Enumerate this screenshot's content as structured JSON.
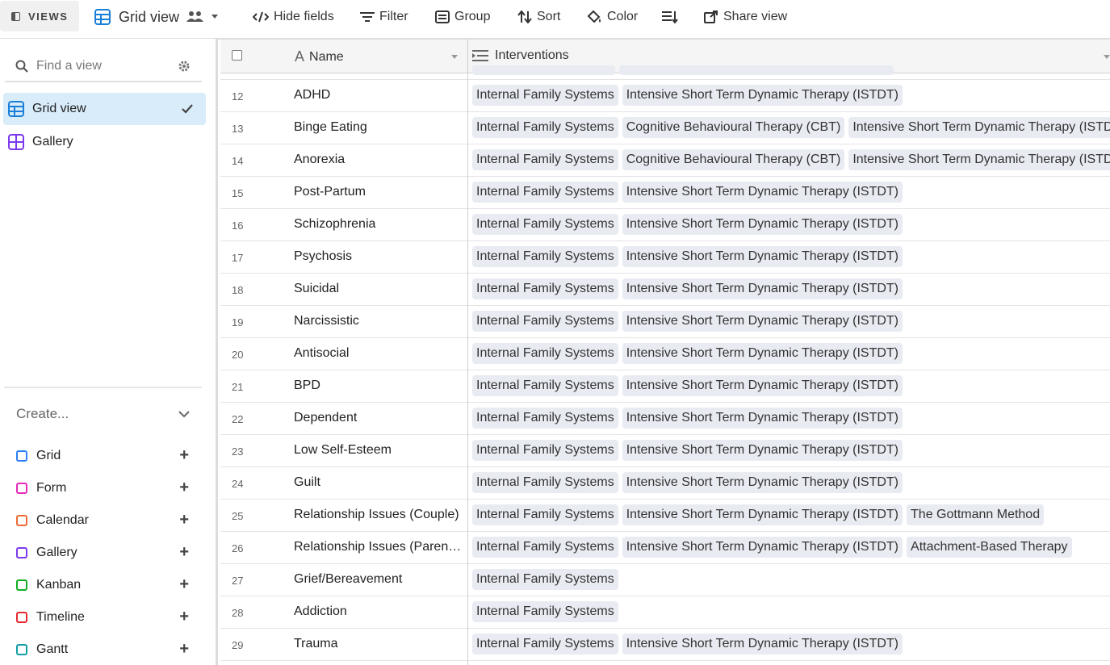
{
  "toolbar": {
    "views_label": "VIEWS",
    "view_title": "Grid view",
    "hide_fields": "Hide fields",
    "filter": "Filter",
    "group": "Group",
    "sort": "Sort",
    "color": "Color",
    "share_view": "Share view"
  },
  "sidebar": {
    "search_placeholder": "Find a view",
    "views": [
      {
        "label": "Grid view",
        "icon": "grid-icon",
        "active": true
      },
      {
        "label": "Gallery",
        "icon": "gallery-icon",
        "active": false
      }
    ],
    "create_label": "Create...",
    "create_items": [
      {
        "label": "Grid",
        "color": "#2d7ff9"
      },
      {
        "label": "Form",
        "color": "#e929ba"
      },
      {
        "label": "Calendar",
        "color": "#f06a36"
      },
      {
        "label": "Gallery",
        "color": "#7c39ed"
      },
      {
        "label": "Kanban",
        "color": "#11af22"
      },
      {
        "label": "Timeline",
        "color": "#e6282e"
      },
      {
        "label": "Gantt",
        "color": "#0f9ea2"
      }
    ]
  },
  "grid": {
    "columns": {
      "name": "Name",
      "interventions": "Interventions"
    },
    "rows": [
      {
        "num": "12",
        "name": "ADHD",
        "tags": [
          "Internal Family Systems",
          "Intensive Short Term Dynamic Therapy (ISTDT)"
        ]
      },
      {
        "num": "13",
        "name": "Binge Eating",
        "tags": [
          "Internal Family Systems",
          "Cognitive Behavioural Therapy (CBT)",
          "Intensive Short Term Dynamic Therapy (ISTDT)"
        ]
      },
      {
        "num": "14",
        "name": "Anorexia",
        "tags": [
          "Internal Family Systems",
          "Cognitive Behavioural Therapy (CBT)",
          "Intensive Short Term Dynamic Therapy (ISTDT)"
        ]
      },
      {
        "num": "15",
        "name": "Post-Partum",
        "tags": [
          "Internal Family Systems",
          "Intensive Short Term Dynamic Therapy (ISTDT)"
        ]
      },
      {
        "num": "16",
        "name": "Schizophrenia",
        "tags": [
          "Internal Family Systems",
          "Intensive Short Term Dynamic Therapy (ISTDT)"
        ]
      },
      {
        "num": "17",
        "name": "Psychosis",
        "tags": [
          "Internal Family Systems",
          "Intensive Short Term Dynamic Therapy (ISTDT)"
        ]
      },
      {
        "num": "18",
        "name": "Suicidal",
        "tags": [
          "Internal Family Systems",
          "Intensive Short Term Dynamic Therapy (ISTDT)"
        ]
      },
      {
        "num": "19",
        "name": "Narcissistic",
        "tags": [
          "Internal Family Systems",
          "Intensive Short Term Dynamic Therapy (ISTDT)"
        ]
      },
      {
        "num": "20",
        "name": "Antisocial",
        "tags": [
          "Internal Family Systems",
          "Intensive Short Term Dynamic Therapy (ISTDT)"
        ]
      },
      {
        "num": "21",
        "name": "BPD",
        "tags": [
          "Internal Family Systems",
          "Intensive Short Term Dynamic Therapy (ISTDT)"
        ]
      },
      {
        "num": "22",
        "name": "Dependent",
        "tags": [
          "Internal Family Systems",
          "Intensive Short Term Dynamic Therapy (ISTDT)"
        ]
      },
      {
        "num": "23",
        "name": "Low Self-Esteem",
        "tags": [
          "Internal Family Systems",
          "Intensive Short Term Dynamic Therapy (ISTDT)"
        ]
      },
      {
        "num": "24",
        "name": "Guilt",
        "tags": [
          "Internal Family Systems",
          "Intensive Short Term Dynamic Therapy (ISTDT)"
        ]
      },
      {
        "num": "25",
        "name": "Relationship Issues (Couple)",
        "tags": [
          "Internal Family Systems",
          "Intensive Short Term Dynamic Therapy (ISTDT)",
          "The Gottmann Method"
        ]
      },
      {
        "num": "26",
        "name": "Relationship Issues (Parent-...",
        "tags": [
          "Internal Family Systems",
          "Intensive Short Term Dynamic Therapy (ISTDT)",
          "Attachment-Based Therapy"
        ]
      },
      {
        "num": "27",
        "name": "Grief/Bereavement",
        "tags": [
          "Internal Family Systems"
        ]
      },
      {
        "num": "28",
        "name": "Addiction",
        "tags": [
          "Internal Family Systems"
        ]
      },
      {
        "num": "29",
        "name": "Trauma",
        "tags": [
          "Internal Family Systems",
          "Intensive Short Term Dynamic Therapy (ISTDT)"
        ]
      }
    ]
  }
}
